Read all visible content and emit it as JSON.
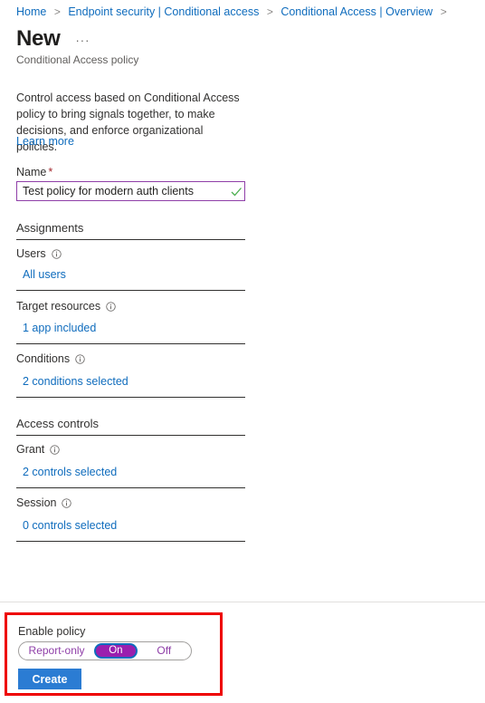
{
  "breadcrumb": {
    "separator": ">",
    "items": [
      {
        "label": "Home"
      },
      {
        "label": "Endpoint security | Conditional access"
      },
      {
        "label": "Conditional Access | Overview"
      }
    ],
    "trailing_separator": ">"
  },
  "header": {
    "title": "New",
    "more_menu": "···",
    "subtitle": "Conditional Access policy"
  },
  "intro": {
    "description": "Control access based on Conditional Access policy to bring signals together, to make decisions, and enforce organizational policies.",
    "learn_more": "Learn more"
  },
  "name_field": {
    "label": "Name",
    "required_marker": "*",
    "value": "Test policy for modern auth clients",
    "placeholder": "",
    "validation_icon": "check-icon",
    "border_color": "#8f3fa8",
    "check_color": "#4caf50"
  },
  "assignments": {
    "heading": "Assignments",
    "rows": [
      {
        "label": "Users",
        "info": "info-icon",
        "value": "All users"
      },
      {
        "label": "Target resources",
        "info": "info-icon",
        "value": "1 app included"
      },
      {
        "label": "Conditions",
        "info": "info-icon",
        "value": "2 conditions selected"
      }
    ]
  },
  "access_controls": {
    "heading": "Access controls",
    "rows": [
      {
        "label": "Grant",
        "info": "info-icon",
        "value": "2 controls selected"
      },
      {
        "label": "Session",
        "info": "info-icon",
        "value": "0 controls selected"
      }
    ]
  },
  "footer": {
    "enable_label": "Enable policy",
    "toggle": {
      "options": [
        "Report-only",
        "On",
        "Off"
      ],
      "selected": "On",
      "selected_bg": "#9a1fae",
      "focus_ring": "#0f6cbd",
      "option_color": "#8f3fa8"
    },
    "create_label": "Create",
    "create_color": "#2b7cd3",
    "highlight_color": "#ee0000"
  },
  "colors": {
    "link": "#0f6cbd",
    "text": "#323130",
    "muted": "#605e5c",
    "required": "#a4262c"
  }
}
